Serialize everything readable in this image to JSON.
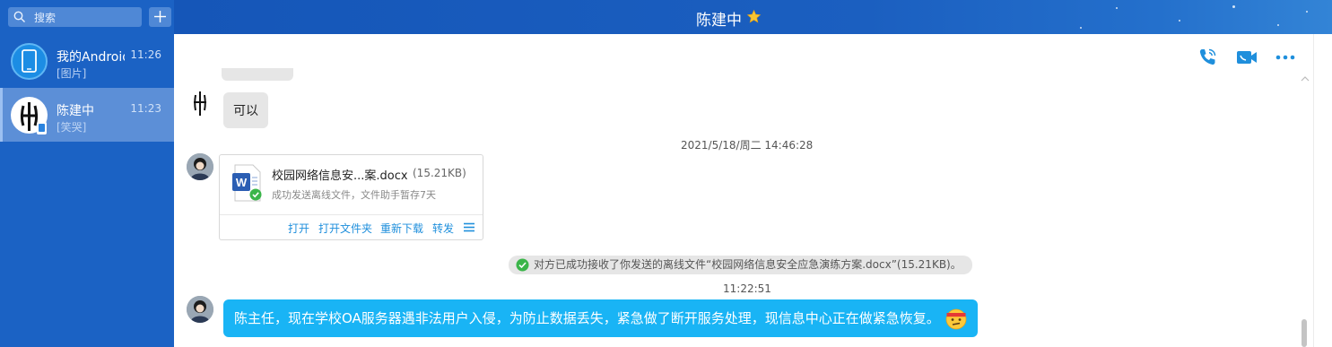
{
  "sidebar": {
    "search_placeholder": "搜索",
    "conversations": [
      {
        "name": "我的Android手机",
        "time": "11:26",
        "preview": "[图片]"
      },
      {
        "name": "陈建中",
        "time": "11:23",
        "preview": "[笑哭]"
      }
    ]
  },
  "header": {
    "title": "陈建中"
  },
  "chat": {
    "messages": [
      {
        "text": "可以"
      }
    ],
    "timestamp1": "2021/5/18/周二 14:46:28",
    "file": {
      "name": "校园网络信息安...案.docx",
      "size": "(15.21KB)",
      "status": "成功发送离线文件，文件助手暂存7天",
      "actions": [
        "打开",
        "打开文件夹",
        "重新下载",
        "转发"
      ]
    },
    "system_note": "对方已成功接收了你发送的离线文件“校园网络信息安全应急演练方案.docx”(15.21KB)。",
    "timestamp2": "11:22:51",
    "last_message": "陈主任，现在学校OA服务器遇非法用户入侵，为防止数据丢失，紧急做了断开服务处理，现信息中心正在做紧急恢复。"
  },
  "colors": {
    "sidebar": "#1b62c4",
    "header": "#1b5fc0",
    "accent_blue": "#19b4f5",
    "link": "#1f8fdc"
  }
}
